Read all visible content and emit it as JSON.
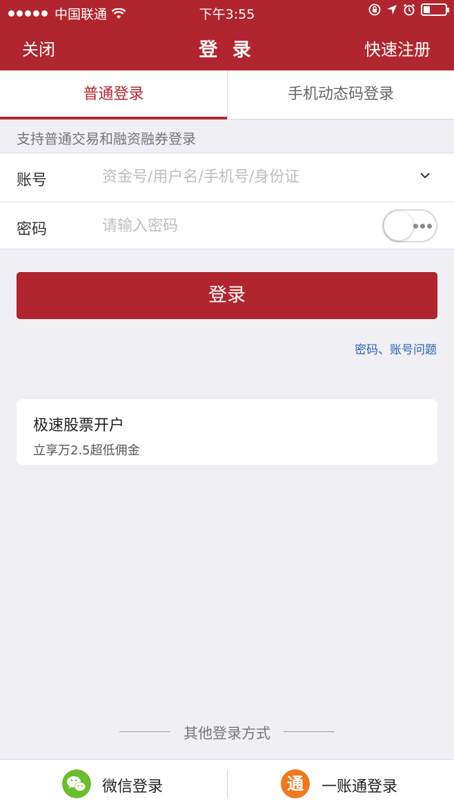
{
  "status_bar": {
    "carrier": "中国联通",
    "time": "下午3:55"
  },
  "nav": {
    "close_label": "关闭",
    "title": "登 录",
    "register_label": "快速注册"
  },
  "tabs": [
    {
      "label": "普通登录",
      "active": true
    },
    {
      "label": "手机动态码登录",
      "active": false
    }
  ],
  "hint": "支持普通交易和融资融券登录",
  "form": {
    "account_label": "账号",
    "account_placeholder": "资金号/用户名/手机号/身份证",
    "password_label": "密码",
    "password_placeholder": "请输入密码"
  },
  "login_button": "登录",
  "help_link": "密码、账号问题",
  "promo": {
    "title": "极速股票开户",
    "subtitle": "立享万2.5超低佣金"
  },
  "other_login": {
    "heading": "其他登录方式",
    "wechat_label": "微信登录",
    "yizhangtong_label": "一账通登录",
    "yizhangtong_glyph": "通"
  },
  "colors": {
    "brand_red": "#b1262e",
    "link_blue": "#2a64b3",
    "wechat_green": "#6bbd2f",
    "yizhangtong_orange": "#f0781e"
  }
}
